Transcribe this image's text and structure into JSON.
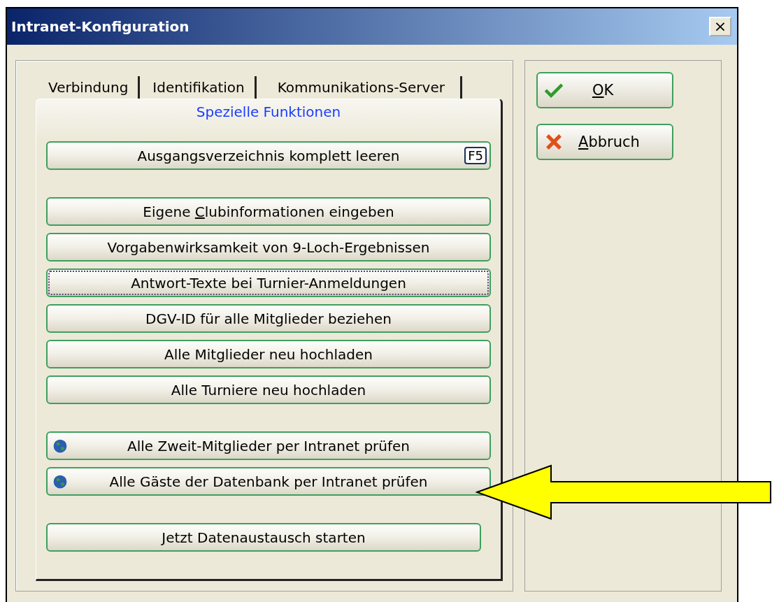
{
  "window": {
    "title": "Intranet-Konfiguration",
    "close": "×"
  },
  "tabs": [
    {
      "label": "Verbindung",
      "selected": false
    },
    {
      "label": "Identifikation",
      "selected": false
    },
    {
      "label": "Kommunikations-Server",
      "selected": false
    },
    {
      "label": "Spezielle Funktionen",
      "selected": true
    }
  ],
  "button_groups": [
    [
      {
        "kind": "plain",
        "pre": "Ausgangsverzeichnis komplett leeren",
        "shortcut": "F5",
        "focused": false
      }
    ],
    [
      {
        "kind": "plain",
        "pre": "Eigene ",
        "key": "C",
        "post": "lubinformationen eingeben",
        "focused": false
      },
      {
        "kind": "plain",
        "pre": "Vorgabenwirksamkeit von 9-Loch-Ergebnissen",
        "focused": false
      },
      {
        "kind": "plain",
        "pre": "Antwort-Texte bei Turnier-Anmeldungen",
        "focused": true
      },
      {
        "kind": "plain",
        "pre": "DGV-ID für alle Mitglieder beziehen",
        "focused": false
      },
      {
        "kind": "plain",
        "pre": "Alle Mitglieder neu hochladen",
        "focused": false
      },
      {
        "kind": "plain",
        "pre": "Alle Turniere neu hochladen",
        "focused": false
      }
    ],
    [
      {
        "kind": "globe",
        "pre": "Alle Zweit-Mitglieder per Intranet prüfen",
        "focused": false
      },
      {
        "kind": "globe",
        "pre": "Alle Gäste der Datenbank per Intranet prüfen",
        "focused": false
      }
    ],
    [
      {
        "kind": "plain",
        "pre": "Jetzt Datenaustausch starten",
        "focused": false
      }
    ]
  ],
  "side_buttons": [
    {
      "kind": "ok",
      "key": "O",
      "post": "K"
    },
    {
      "kind": "cancel",
      "key": "A",
      "post": "bbruch"
    }
  ]
}
